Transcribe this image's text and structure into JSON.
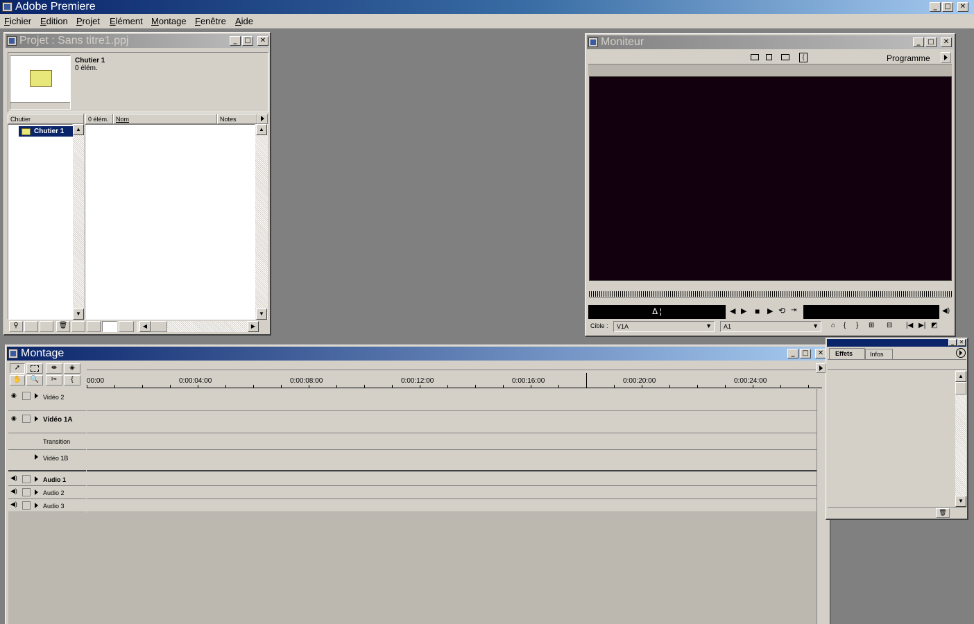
{
  "app": {
    "title": "Adobe Premiere"
  },
  "menu": [
    "Fichier",
    "Edition",
    "Projet",
    "Elément",
    "Montage",
    "Fenêtre",
    "Aide"
  ],
  "project": {
    "title": "Projet : Sans titre1.ppj",
    "bin_name": "Chutier 1",
    "bin_count": "0 élém.",
    "col_bin": "Chutier",
    "col_count": "0 élém.",
    "col_name": "Nom",
    "col_notes": "Notes",
    "tree_item": "Chutier 1"
  },
  "monitor": {
    "title": "Moniteur",
    "mode": "Programme",
    "target_label": "Cible :",
    "target_video": "V1A",
    "target_audio": "A1",
    "screen_color": "#12000f"
  },
  "timeline": {
    "title": "Montage",
    "ruler": [
      "00:00",
      "0:00:04:00",
      "0:00:08:00",
      "0:00:12:00",
      "0:00:16:00",
      "0:00:20:00",
      "0:00:24:00"
    ],
    "tracks": {
      "video2": "Vidéo 2",
      "video1a": "Vidéo 1A",
      "transition": "Transition",
      "video1b": "Vidéo 1B",
      "audio1": "Audio 1",
      "audio2": "Audio 2",
      "audio3": "Audio 3"
    }
  },
  "effects": {
    "tab_effects": "Effets",
    "tab_infos": "Infos"
  },
  "colors": {
    "face": "#d4d0c8",
    "title_active": "#0a246a",
    "desktop": "#808080"
  }
}
